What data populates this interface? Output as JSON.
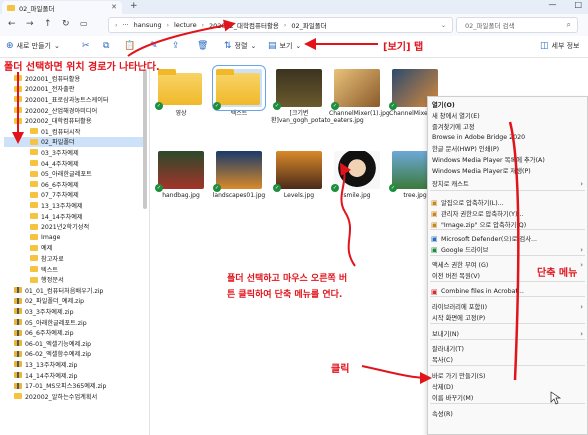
{
  "window": {
    "tab_title": "02_파일폴더",
    "tab_close": "✕",
    "new_tab": "+",
    "minimize": "—",
    "maximize": "□"
  },
  "address": {
    "back": "←",
    "forward": "→",
    "up": "↑",
    "refresh": "↻",
    "more": "···",
    "path": [
      "hansung",
      "lecture",
      "202002_대학컴퓨터활용",
      "02_파일폴더"
    ],
    "search_placeholder": "02_파일폴더 검색",
    "search_icon": "⌕"
  },
  "toolbar": {
    "new_label": "새로 만들기",
    "sort_label": "정렬",
    "view_label": "보기",
    "more": "···",
    "details_label": "세부 정보"
  },
  "sidebar": {
    "items": [
      {
        "label": "202001_컴퓨터활용",
        "type": "folder"
      },
      {
        "label": "202001_전자출판",
        "type": "folder"
      },
      {
        "label": "202001_표로삼과농트스케이터",
        "type": "folder"
      },
      {
        "label": "202002_산업해경아미디어",
        "type": "folder"
      },
      {
        "label": "202002_대학컴퓨터활용",
        "type": "folder"
      },
      {
        "label": "01_컴퓨터시작",
        "type": "folder"
      },
      {
        "label": "02_파일폴더",
        "type": "folder"
      },
      {
        "label": "03_3주차예제",
        "type": "folder"
      },
      {
        "label": "04_4주차예제",
        "type": "folder"
      },
      {
        "label": "05_아래한글레포트",
        "type": "folder"
      },
      {
        "label": "06_6주차예제",
        "type": "folder"
      },
      {
        "label": "07_7주차예제",
        "type": "folder"
      },
      {
        "label": "13_13주차예제",
        "type": "folder"
      },
      {
        "label": "14_14주차예제",
        "type": "folder"
      },
      {
        "label": "2021년2학기성적",
        "type": "folder"
      },
      {
        "label": "Image",
        "type": "folder"
      },
      {
        "label": "예제",
        "type": "folder"
      },
      {
        "label": "참고자료",
        "type": "folder"
      },
      {
        "label": "텍스트",
        "type": "folder"
      },
      {
        "label": "행정문서",
        "type": "folder"
      },
      {
        "label": "01_01_컴퓨터처음배우기.zip",
        "type": "zip"
      },
      {
        "label": "02_파일폴더_예제.zip",
        "type": "zip"
      },
      {
        "label": "03_3주차예제.zip",
        "type": "zip"
      },
      {
        "label": "05_아래한글레포트.zip",
        "type": "zip"
      },
      {
        "label": "06_6주차예제.zip",
        "type": "zip"
      },
      {
        "label": "06-01_엑셀기능예제.zip",
        "type": "zip"
      },
      {
        "label": "06-02_엑셀함수예제.zip",
        "type": "zip"
      },
      {
        "label": "13_13주차예제.zip",
        "type": "zip"
      },
      {
        "label": "14_14주차예제.zip",
        "type": "zip"
      },
      {
        "label": "17-01_MS오피스365예제.zip",
        "type": "zip"
      },
      {
        "label": "202002_알하는수업계획서",
        "type": "folder"
      }
    ]
  },
  "files": [
    {
      "name": "영상",
      "kind": "folder"
    },
    {
      "name": "텍스트",
      "kind": "folder-selected"
    },
    {
      "name": "[크기변환]van_gogh_potato_eaters.jpg",
      "kind": "image"
    },
    {
      "name": "ChannelMixer(1).jpg",
      "kind": "image"
    },
    {
      "name": "ChannelMixer.jpg",
      "kind": "image"
    },
    {
      "name": "handbag.jpg",
      "kind": "image"
    },
    {
      "name": "landscapes01.jpg",
      "kind": "image"
    },
    {
      "name": "Levels.jpg",
      "kind": "image"
    },
    {
      "name": "smile.jpg",
      "kind": "image"
    },
    {
      "name": "tree.jpg",
      "kind": "image"
    }
  ],
  "context_menu": {
    "items": [
      {
        "label": "열기(O)",
        "bold": true
      },
      {
        "label": "새 창에서 열기(E)"
      },
      {
        "label": "즐겨찾기에 고정"
      },
      {
        "label": "Browse in Adobe Bridge 2020"
      },
      {
        "label": "한글 문서(HWP) 인쇄(P)"
      },
      {
        "label": "Windows Media Player 목록에 추가(A)"
      },
      {
        "label": "Windows Media Player로 재생(P)"
      },
      {
        "label": "장치로 캐스트",
        "arrow": true
      },
      {
        "label": "알집으로 압축하기(L)...",
        "icon": true
      },
      {
        "label": "관리자 권한으로 압축하기(Y)...",
        "icon": true
      },
      {
        "label": "\"Image.zip\" 으로 압축하기(Q)",
        "icon": true
      },
      {
        "label": "Microsoft Defender(으)로 검사...",
        "icon": true
      },
      {
        "label": "Google 드라이브",
        "icon": true,
        "arrow": true
      },
      {
        "label": "액세스 권한 부여 (G)",
        "arrow": true
      },
      {
        "label": "이전 버전 복원(V)"
      },
      {
        "label": "Combine files in Acrobat...",
        "icon": true
      },
      {
        "label": "라이브러리에 포함(I)",
        "arrow": true
      },
      {
        "label": "시작 화면에 고정(P)"
      },
      {
        "label": "보내기(N)",
        "arrow": true
      },
      {
        "label": "잘라내기(T)"
      },
      {
        "label": "복사(C)"
      },
      {
        "label": "바로 가기 만들기(S)"
      },
      {
        "label": "삭제(D)"
      },
      {
        "label": "이름 바꾸기(M)"
      },
      {
        "label": "속성(R)"
      }
    ]
  },
  "annotations": {
    "view_tab": "[보기] 탭",
    "path_note": "폴더 선택하면 위치 경로가 나타난다.",
    "right_click_line1": "폴더 선택하고 마우스 오른쪽 버",
    "right_click_line2": "튼 클릭하여 단축 메뉴를 연다.",
    "shortcut_menu": "단축 메뉴",
    "click": "클릭"
  },
  "colors": {
    "annotation_red": "#e1141c",
    "selection_blue": "#cde1f8",
    "folder_yellow": "#f5c242",
    "sync_green": "#1e8e3e"
  }
}
